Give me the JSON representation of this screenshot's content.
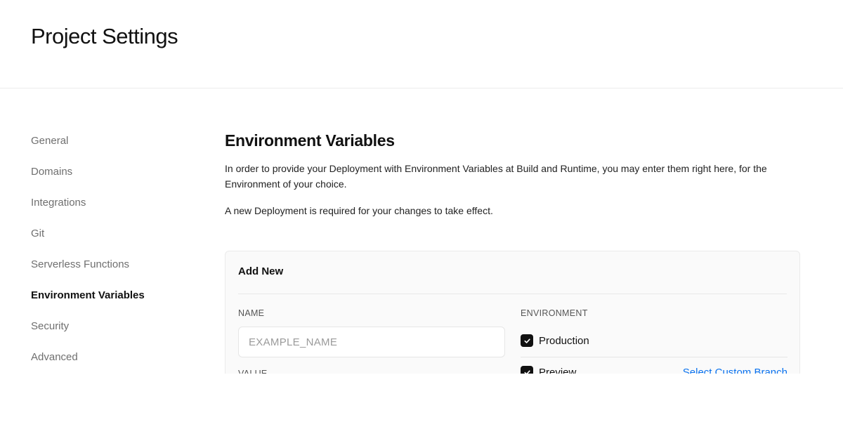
{
  "header": {
    "title": "Project Settings"
  },
  "sidebar": {
    "items": [
      {
        "label": "General",
        "active": false
      },
      {
        "label": "Domains",
        "active": false
      },
      {
        "label": "Integrations",
        "active": false
      },
      {
        "label": "Git",
        "active": false
      },
      {
        "label": "Serverless Functions",
        "active": false
      },
      {
        "label": "Environment Variables",
        "active": true
      },
      {
        "label": "Security",
        "active": false
      },
      {
        "label": "Advanced",
        "active": false
      }
    ]
  },
  "main": {
    "title": "Environment Variables",
    "description": "In order to provide your Deployment with Environment Variables at Build and Runtime, you may enter them right here, for the Environment of your choice.",
    "note": "A new Deployment is required for your changes to take effect.",
    "add_new": {
      "title": "Add New",
      "name_label": "NAME",
      "name_placeholder": "EXAMPLE_NAME",
      "name_value": "",
      "value_label": "VALUE",
      "environment_label": "ENVIRONMENT",
      "environments": [
        {
          "label": "Production",
          "checked": true,
          "icon": "checkmark-icon"
        },
        {
          "label": "Preview",
          "checked": true,
          "icon": "checkmark-icon",
          "link": "Select Custom Branch"
        }
      ]
    }
  },
  "colors": {
    "accent_link": "#0a72ef",
    "checkbox": "#111111",
    "muted_text": "#6f6f6f"
  }
}
